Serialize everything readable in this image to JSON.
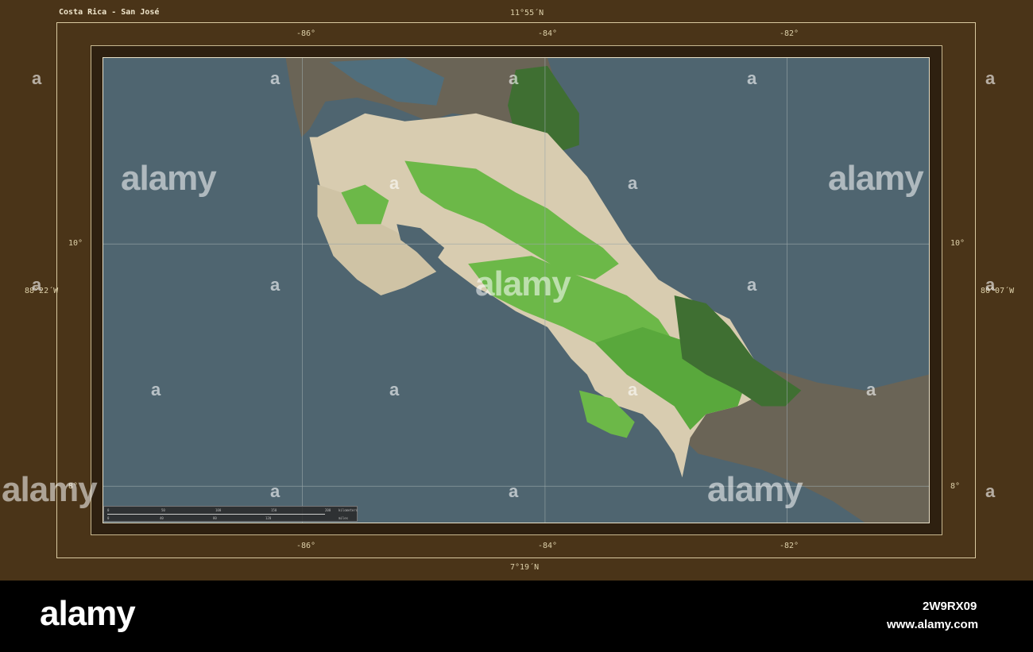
{
  "map": {
    "title": "Costa Rica - San José",
    "top_coord": "11°55´N",
    "bottom_coord": "7°19´N",
    "left_coord": "88°22´W",
    "right_coord": "80°07´W",
    "lon_labels": [
      "-86°",
      "-84°",
      "-82°"
    ],
    "lat_labels": [
      "10°",
      "8°"
    ],
    "scale": {
      "km_label": "kilometers",
      "mi_label": "miles",
      "km_ticks": [
        "0",
        "50",
        "100",
        "150",
        "200"
      ],
      "mi_ticks": [
        "0",
        "40",
        "80",
        "120"
      ]
    },
    "colors": {
      "frame": "#4a3418",
      "ocean": "#4f6570",
      "land_costa_rica": "#d8ccb0",
      "forest": "#6cb848",
      "neighbor_land": "#6a6456"
    }
  },
  "watermark": {
    "brand": "alamy",
    "mark": "a",
    "image_id": "2W9RX09",
    "site": "www.alamy.com"
  }
}
